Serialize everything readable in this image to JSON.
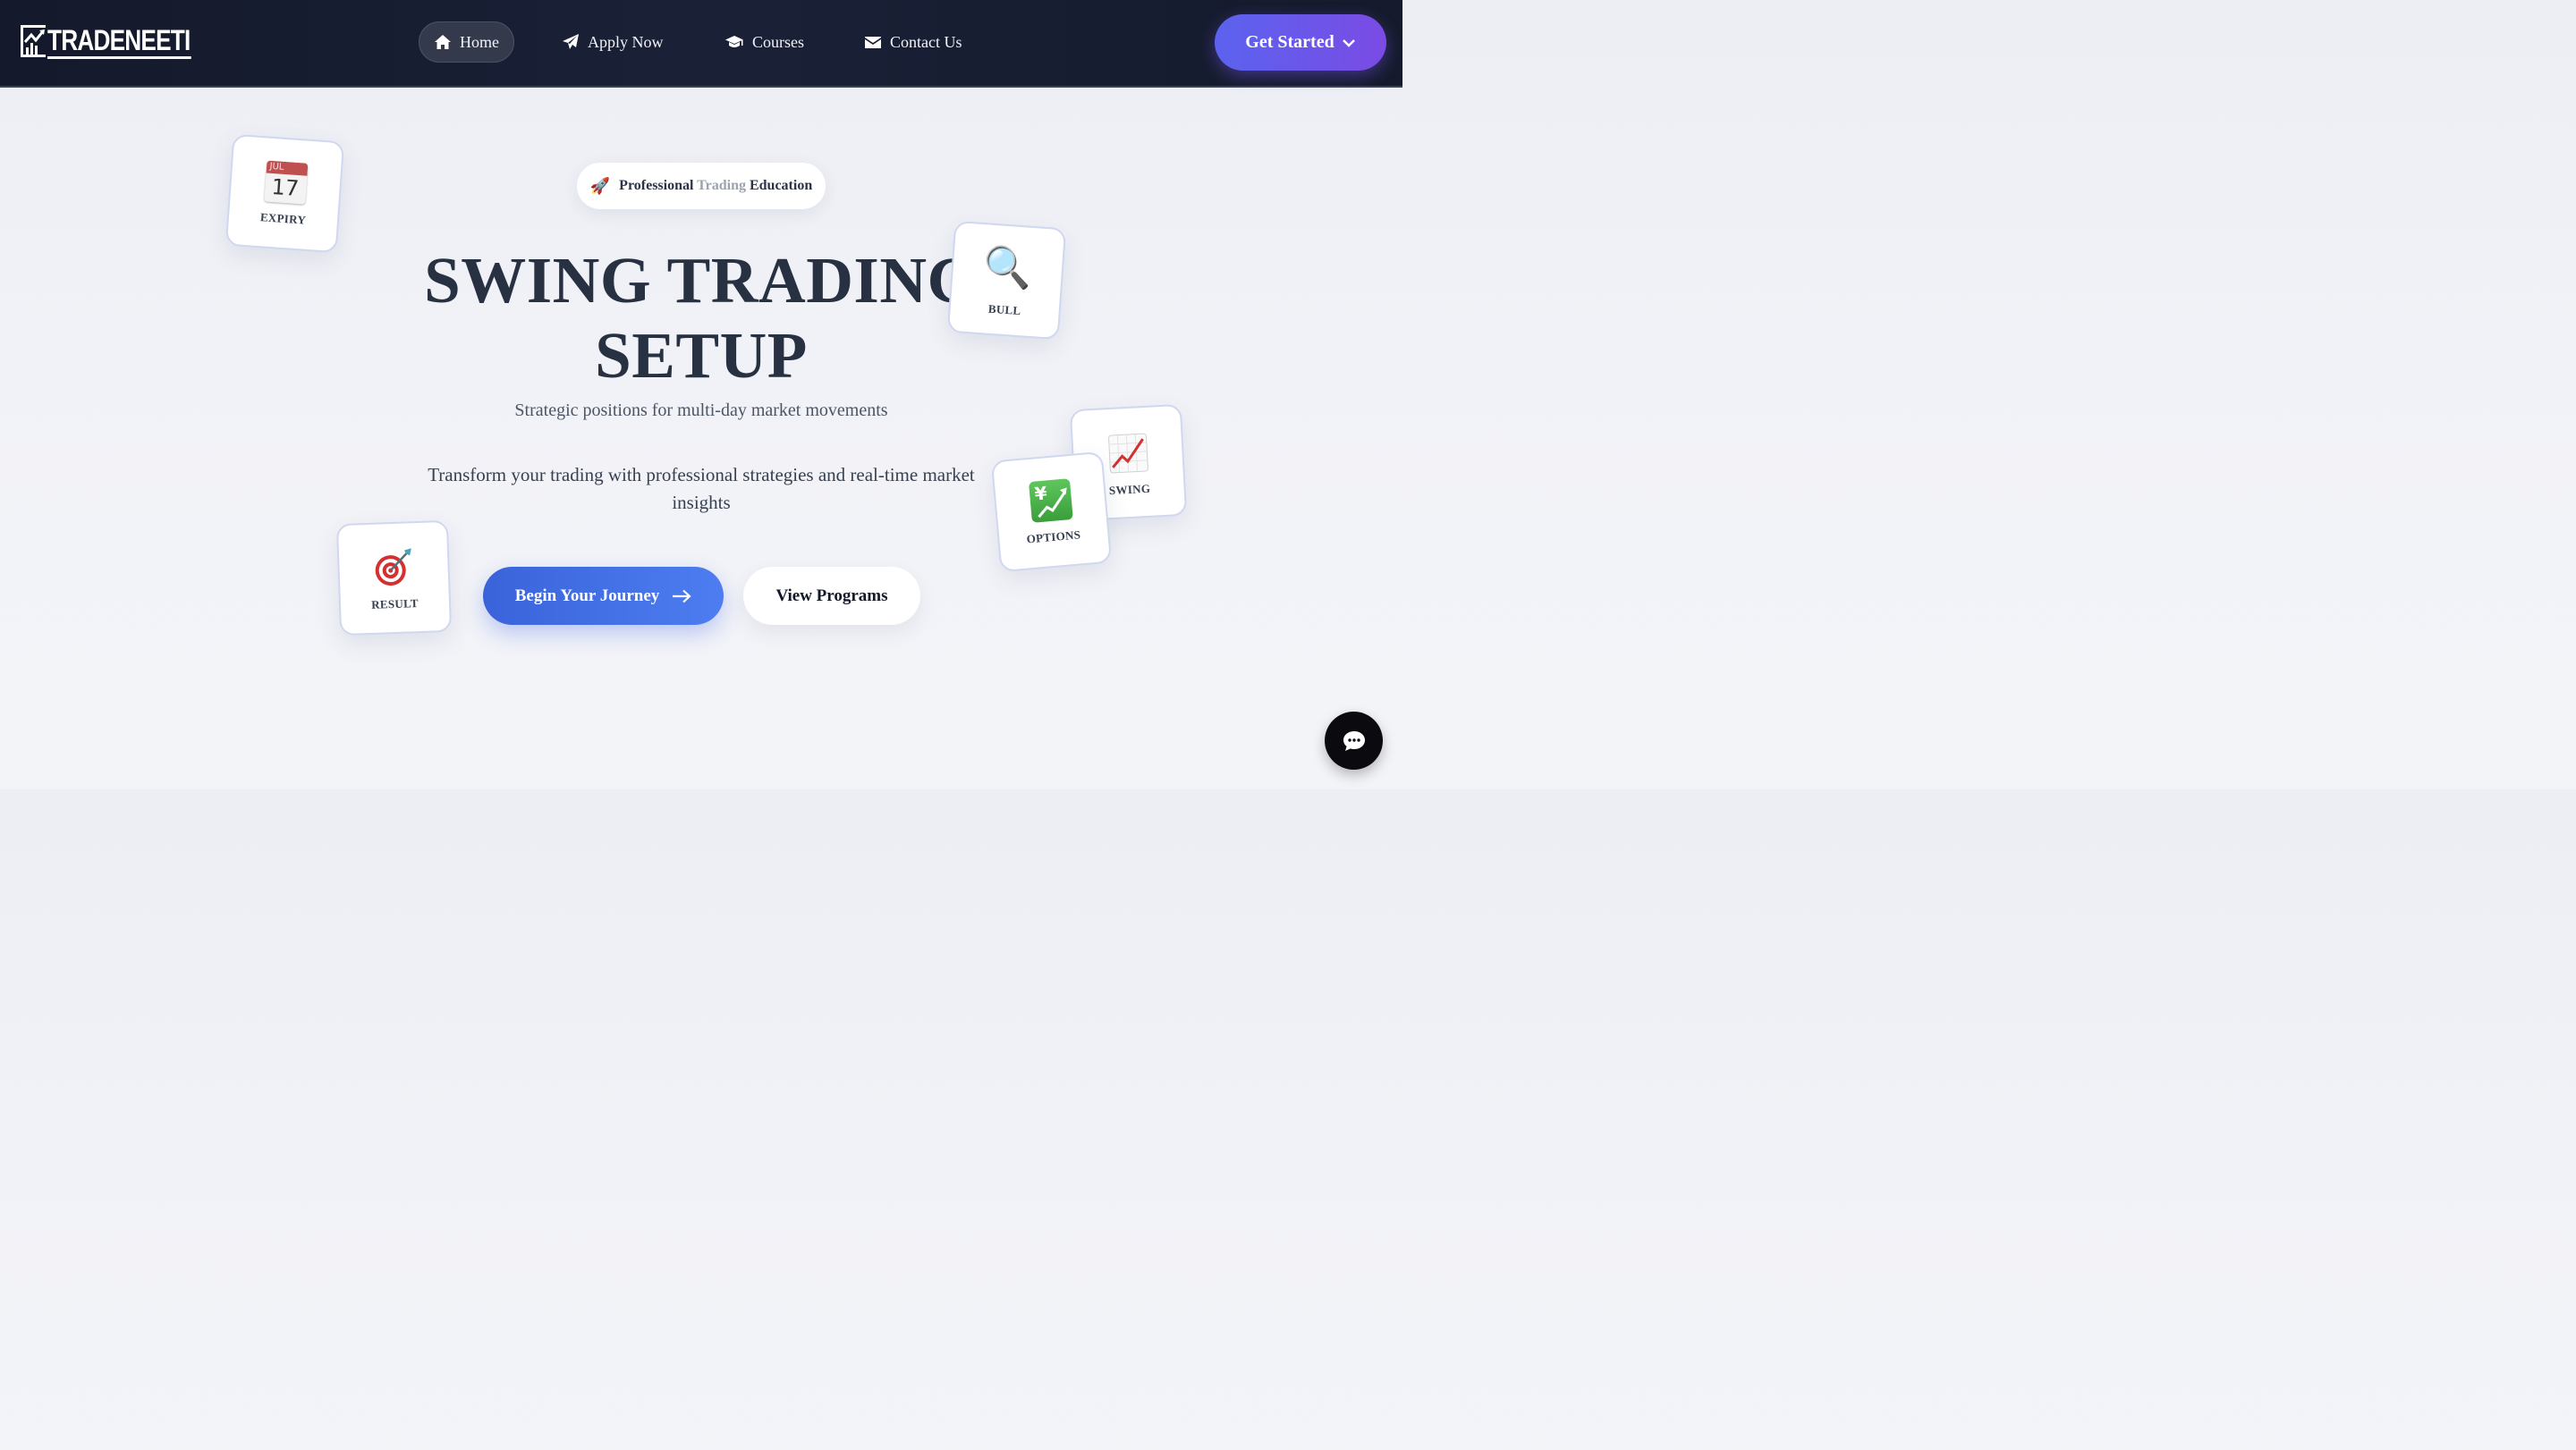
{
  "brand": {
    "logo_text": "TRADENEETI"
  },
  "nav": {
    "items": [
      {
        "label": "Home",
        "icon": "home-icon",
        "active": true
      },
      {
        "label": "Apply Now",
        "icon": "paper-plane-icon"
      },
      {
        "label": "Courses",
        "icon": "graduation-cap-icon"
      },
      {
        "label": "Contact Us",
        "icon": "envelope-icon"
      }
    ],
    "cta_label": "Get Started",
    "cta_icon": "chevron-down-icon"
  },
  "hero": {
    "badge": {
      "icon": "🚀",
      "word1": "Professional",
      "word2": "Trading",
      "word3": "Education"
    },
    "title_line1": "SWING TRADING",
    "title_line2": "SETUP",
    "subtitle": "Strategic positions for multi-day market movements",
    "description": "Transform your trading with professional strategies and real-time market insights",
    "primary_button": "Begin Your Journey",
    "secondary_button": "View Programs"
  },
  "cards": {
    "expiry": {
      "label": "EXPIRY",
      "month": "JUL",
      "day": "17",
      "icon": "calendar-icon"
    },
    "bull": {
      "label": "BULL",
      "emoji": "🔍",
      "icon": "magnifier-icon"
    },
    "swing": {
      "label": "SWING",
      "icon": "chart-increasing-icon"
    },
    "options": {
      "label": "OPTIONS",
      "symbol": "¥",
      "icon": "yen-chart-icon"
    },
    "result": {
      "label": "RESULT",
      "icon": "target-icon"
    }
  },
  "colors": {
    "nav_bg": "#141a2b",
    "accent_blue": "#3a63da",
    "accent_purple": "#7a4be4",
    "title_text": "#273142"
  }
}
